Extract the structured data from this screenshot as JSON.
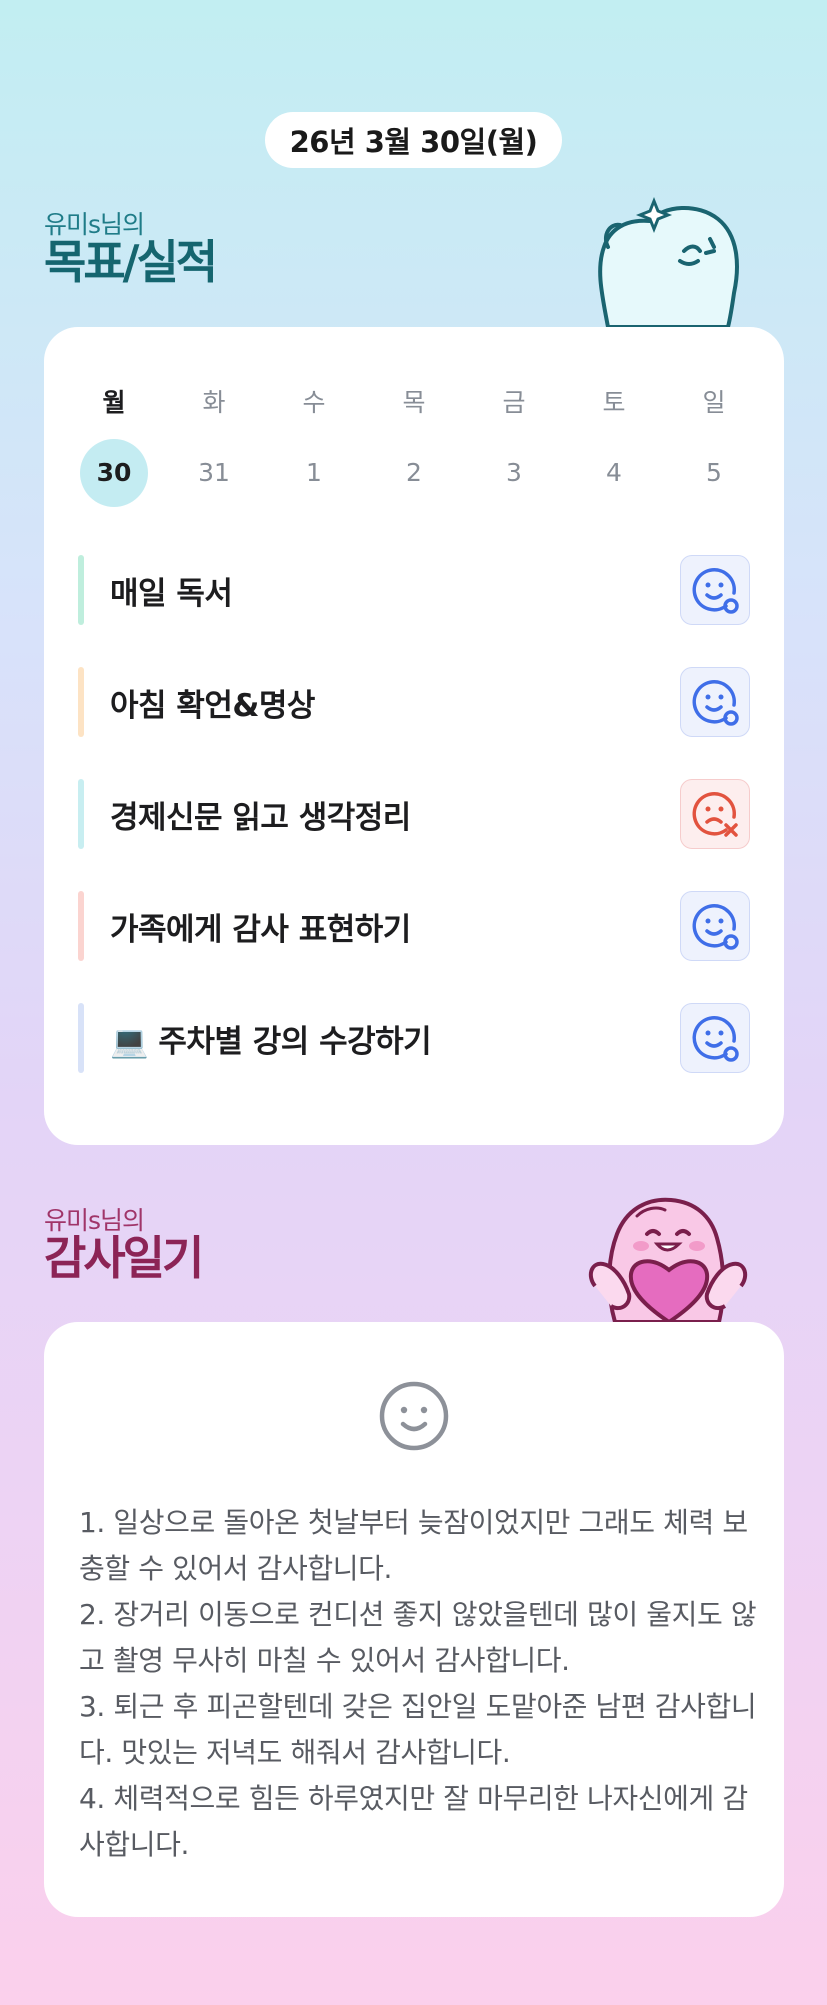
{
  "header": {
    "date": "26년 3월 30일(월)"
  },
  "goals_section": {
    "owner": "유미s님의",
    "title": "목표/실적"
  },
  "week": {
    "weekdays": [
      "월",
      "화",
      "수",
      "목",
      "금",
      "토",
      "일"
    ],
    "dates": [
      "30",
      "31",
      "1",
      "2",
      "3",
      "4",
      "5"
    ],
    "selected_index": 0
  },
  "goals": [
    {
      "label": "매일 독서",
      "status": "done",
      "bar_color": "#bfeedd"
    },
    {
      "label": "아침 확언&명상",
      "status": "done",
      "bar_color": "#fde3c4"
    },
    {
      "label": "경제신문 읽고 생각정리",
      "status": "fail",
      "bar_color": "#c8eef1"
    },
    {
      "label": "가족에게 감사 표현하기",
      "status": "done",
      "bar_color": "#fbd4d0"
    },
    {
      "label": "💻 주차별 강의 수강하기",
      "status": "done",
      "bar_color": "#d8e2f8"
    }
  ],
  "diary_section": {
    "owner": "유미s님의",
    "title": "감사일기"
  },
  "diary": {
    "mood_icon": "smile-face-icon",
    "lines": [
      "1. 일상으로 돌아온 첫날부터 늦잠이었지만 그래도 체력 보충할 수 있어서 감사합니다.",
      "2. 장거리 이동으로 컨디션 좋지 않았을텐데 많이 울지도 않고 촬영 무사히 마칠 수 있어서 감사합니다.",
      "3. 퇴근 후 피곤할텐데 갖은 집안일 도맡아준 남편 감사합니다. 맛있는 저녁도 해줘서 감사합니다.",
      "4. 체력적으로 힘든 하루였지만 잘 마무리한 나자신에게 감사합니다."
    ]
  },
  "colors": {
    "accent_teal": "#15656f",
    "accent_pink": "#8c2456",
    "done_icon": "#3f6ee8",
    "fail_icon": "#e2533f"
  }
}
